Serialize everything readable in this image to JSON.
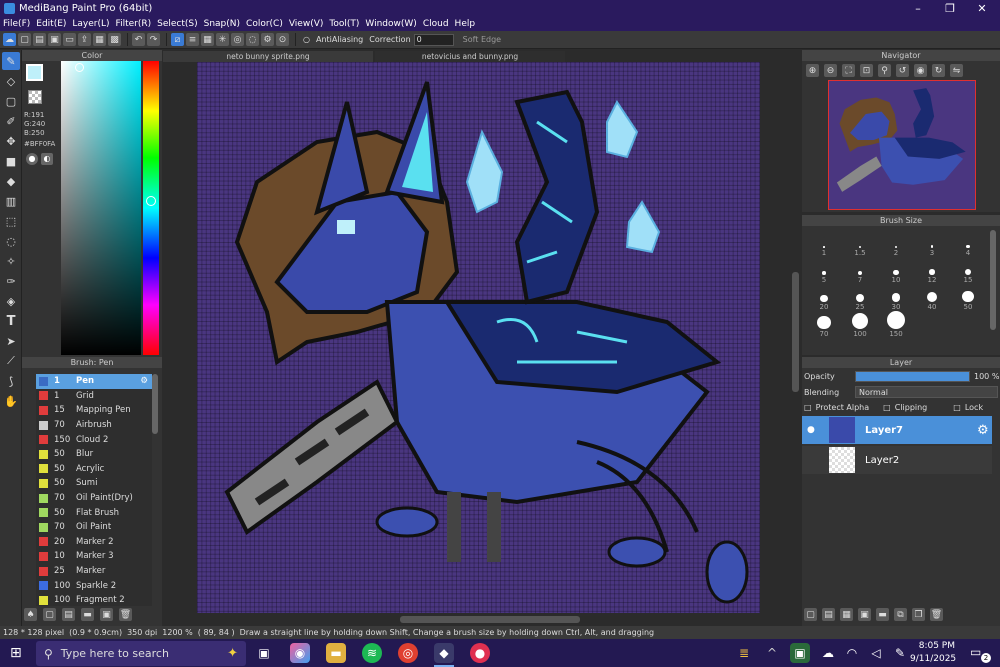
{
  "window": {
    "title": "MediBang Paint Pro (64bit)",
    "minimize": "–",
    "maximize": "❐",
    "close": "✕"
  },
  "menu": [
    "File(F)",
    "Edit(E)",
    "Layer(L)",
    "Filter(R)",
    "Select(S)",
    "Snap(N)",
    "Color(C)",
    "View(V)",
    "Tool(T)",
    "Window(W)",
    "Cloud",
    "Help"
  ],
  "toolbar": {
    "antialiasing": "AntiAliasing",
    "correction_label": "Correction",
    "correction_value": "0",
    "soft_edge": "Soft Edge"
  },
  "color_panel": {
    "title": "Color",
    "r": "R:191",
    "g": "G:240",
    "b": "B:250",
    "hex": "#BFF0FA",
    "foreground": "#bff0fa"
  },
  "brush_panel": {
    "title": "Brush: Pen",
    "brushes": [
      {
        "size": "1",
        "name": "Pen",
        "color": "#3a6bc4",
        "selected": true
      },
      {
        "size": "1",
        "name": "Grid",
        "color": "#e03c3c"
      },
      {
        "size": "15",
        "name": "Mapping Pen",
        "color": "#e03c3c"
      },
      {
        "size": "70",
        "name": "Airbrush",
        "color": "#cccccc"
      },
      {
        "size": "150",
        "name": "Cloud 2",
        "color": "#e03c3c"
      },
      {
        "size": "50",
        "name": "Blur",
        "color": "#e0e03c"
      },
      {
        "size": "50",
        "name": "Acrylic",
        "color": "#e0e03c"
      },
      {
        "size": "50",
        "name": "Sumi",
        "color": "#e0e03c"
      },
      {
        "size": "70",
        "name": "Oil Paint(Dry)",
        "color": "#a0d860"
      },
      {
        "size": "50",
        "name": "Flat Brush",
        "color": "#a0d860"
      },
      {
        "size": "70",
        "name": "Oil Paint",
        "color": "#a0d860"
      },
      {
        "size": "20",
        "name": "Marker 2",
        "color": "#e03c3c"
      },
      {
        "size": "10",
        "name": "Marker 3",
        "color": "#e03c3c"
      },
      {
        "size": "25",
        "name": "Marker",
        "color": "#e03c3c"
      },
      {
        "size": "100",
        "name": "Sparkle 2",
        "color": "#3c6ce0"
      },
      {
        "size": "100",
        "name": "Fragment 2",
        "color": "#e0e03c"
      }
    ]
  },
  "documents": {
    "tab1": "neto bunny sprite.png",
    "tab2": "netovicius and bunny.png"
  },
  "navigator": {
    "title": "Navigator"
  },
  "brush_size": {
    "title": "Brush Size",
    "sizes": [
      "1",
      "1.5",
      "2",
      "3",
      "4",
      "5",
      "7",
      "10",
      "12",
      "15",
      "20",
      "25",
      "30",
      "40",
      "50",
      "70",
      "100",
      "150"
    ]
  },
  "layer_panel": {
    "title": "Layer",
    "opacity_label": "Opacity",
    "opacity_value": "100 %",
    "opacity_fraction": 1.0,
    "blending_label": "Blending",
    "blending_value": "Normal",
    "protect_alpha": "Protect Alpha",
    "clipping": "Clipping",
    "lock": "Lock",
    "layers": [
      {
        "name": "Layer7",
        "selected": true
      },
      {
        "name": "Layer2",
        "selected": false
      }
    ]
  },
  "status": {
    "size": "128 * 128 pixel",
    "physical": "(0.9 * 0.9cm)",
    "dpi": "350 dpi",
    "zoom": "1200 %",
    "coords": "( 89, 84 )",
    "hint": "Draw a straight line by holding down Shift, Change a brush size by holding down Ctrl, Alt, and dragging"
  },
  "taskbar": {
    "search_placeholder": "Type here to search",
    "time": "8:05 PM",
    "date": "9/11/2025",
    "notification_count": "2"
  }
}
